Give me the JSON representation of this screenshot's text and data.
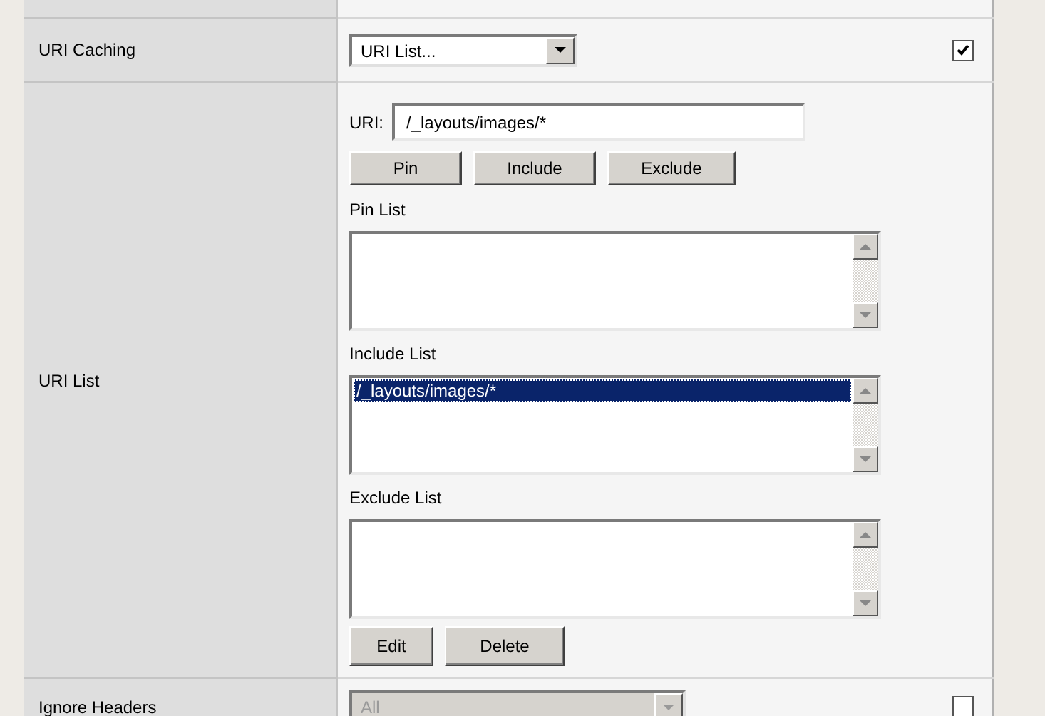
{
  "rows": [
    {
      "kind": "select",
      "label": "URI Caching",
      "select": {
        "value": "URI List...",
        "disabled": false
      },
      "checked": true
    },
    {
      "kind": "list-editor",
      "label": "URI List",
      "uri": {
        "label": "URI:",
        "value": "/_layouts/images/*"
      },
      "actions": [
        "Pin",
        "Include",
        "Exclude"
      ],
      "lists": [
        {
          "title": "Pin List"
        },
        {
          "title": "Include List",
          "items": [
            {
              "text": "/_layouts/images/*",
              "selected": true
            }
          ]
        },
        {
          "title": "Exclude List"
        }
      ],
      "buttons": [
        "Edit",
        "Delete"
      ]
    },
    {
      "kind": "select",
      "label": "Ignore Headers",
      "select": {
        "value": "All",
        "disabled": true
      },
      "checked": false
    }
  ]
}
